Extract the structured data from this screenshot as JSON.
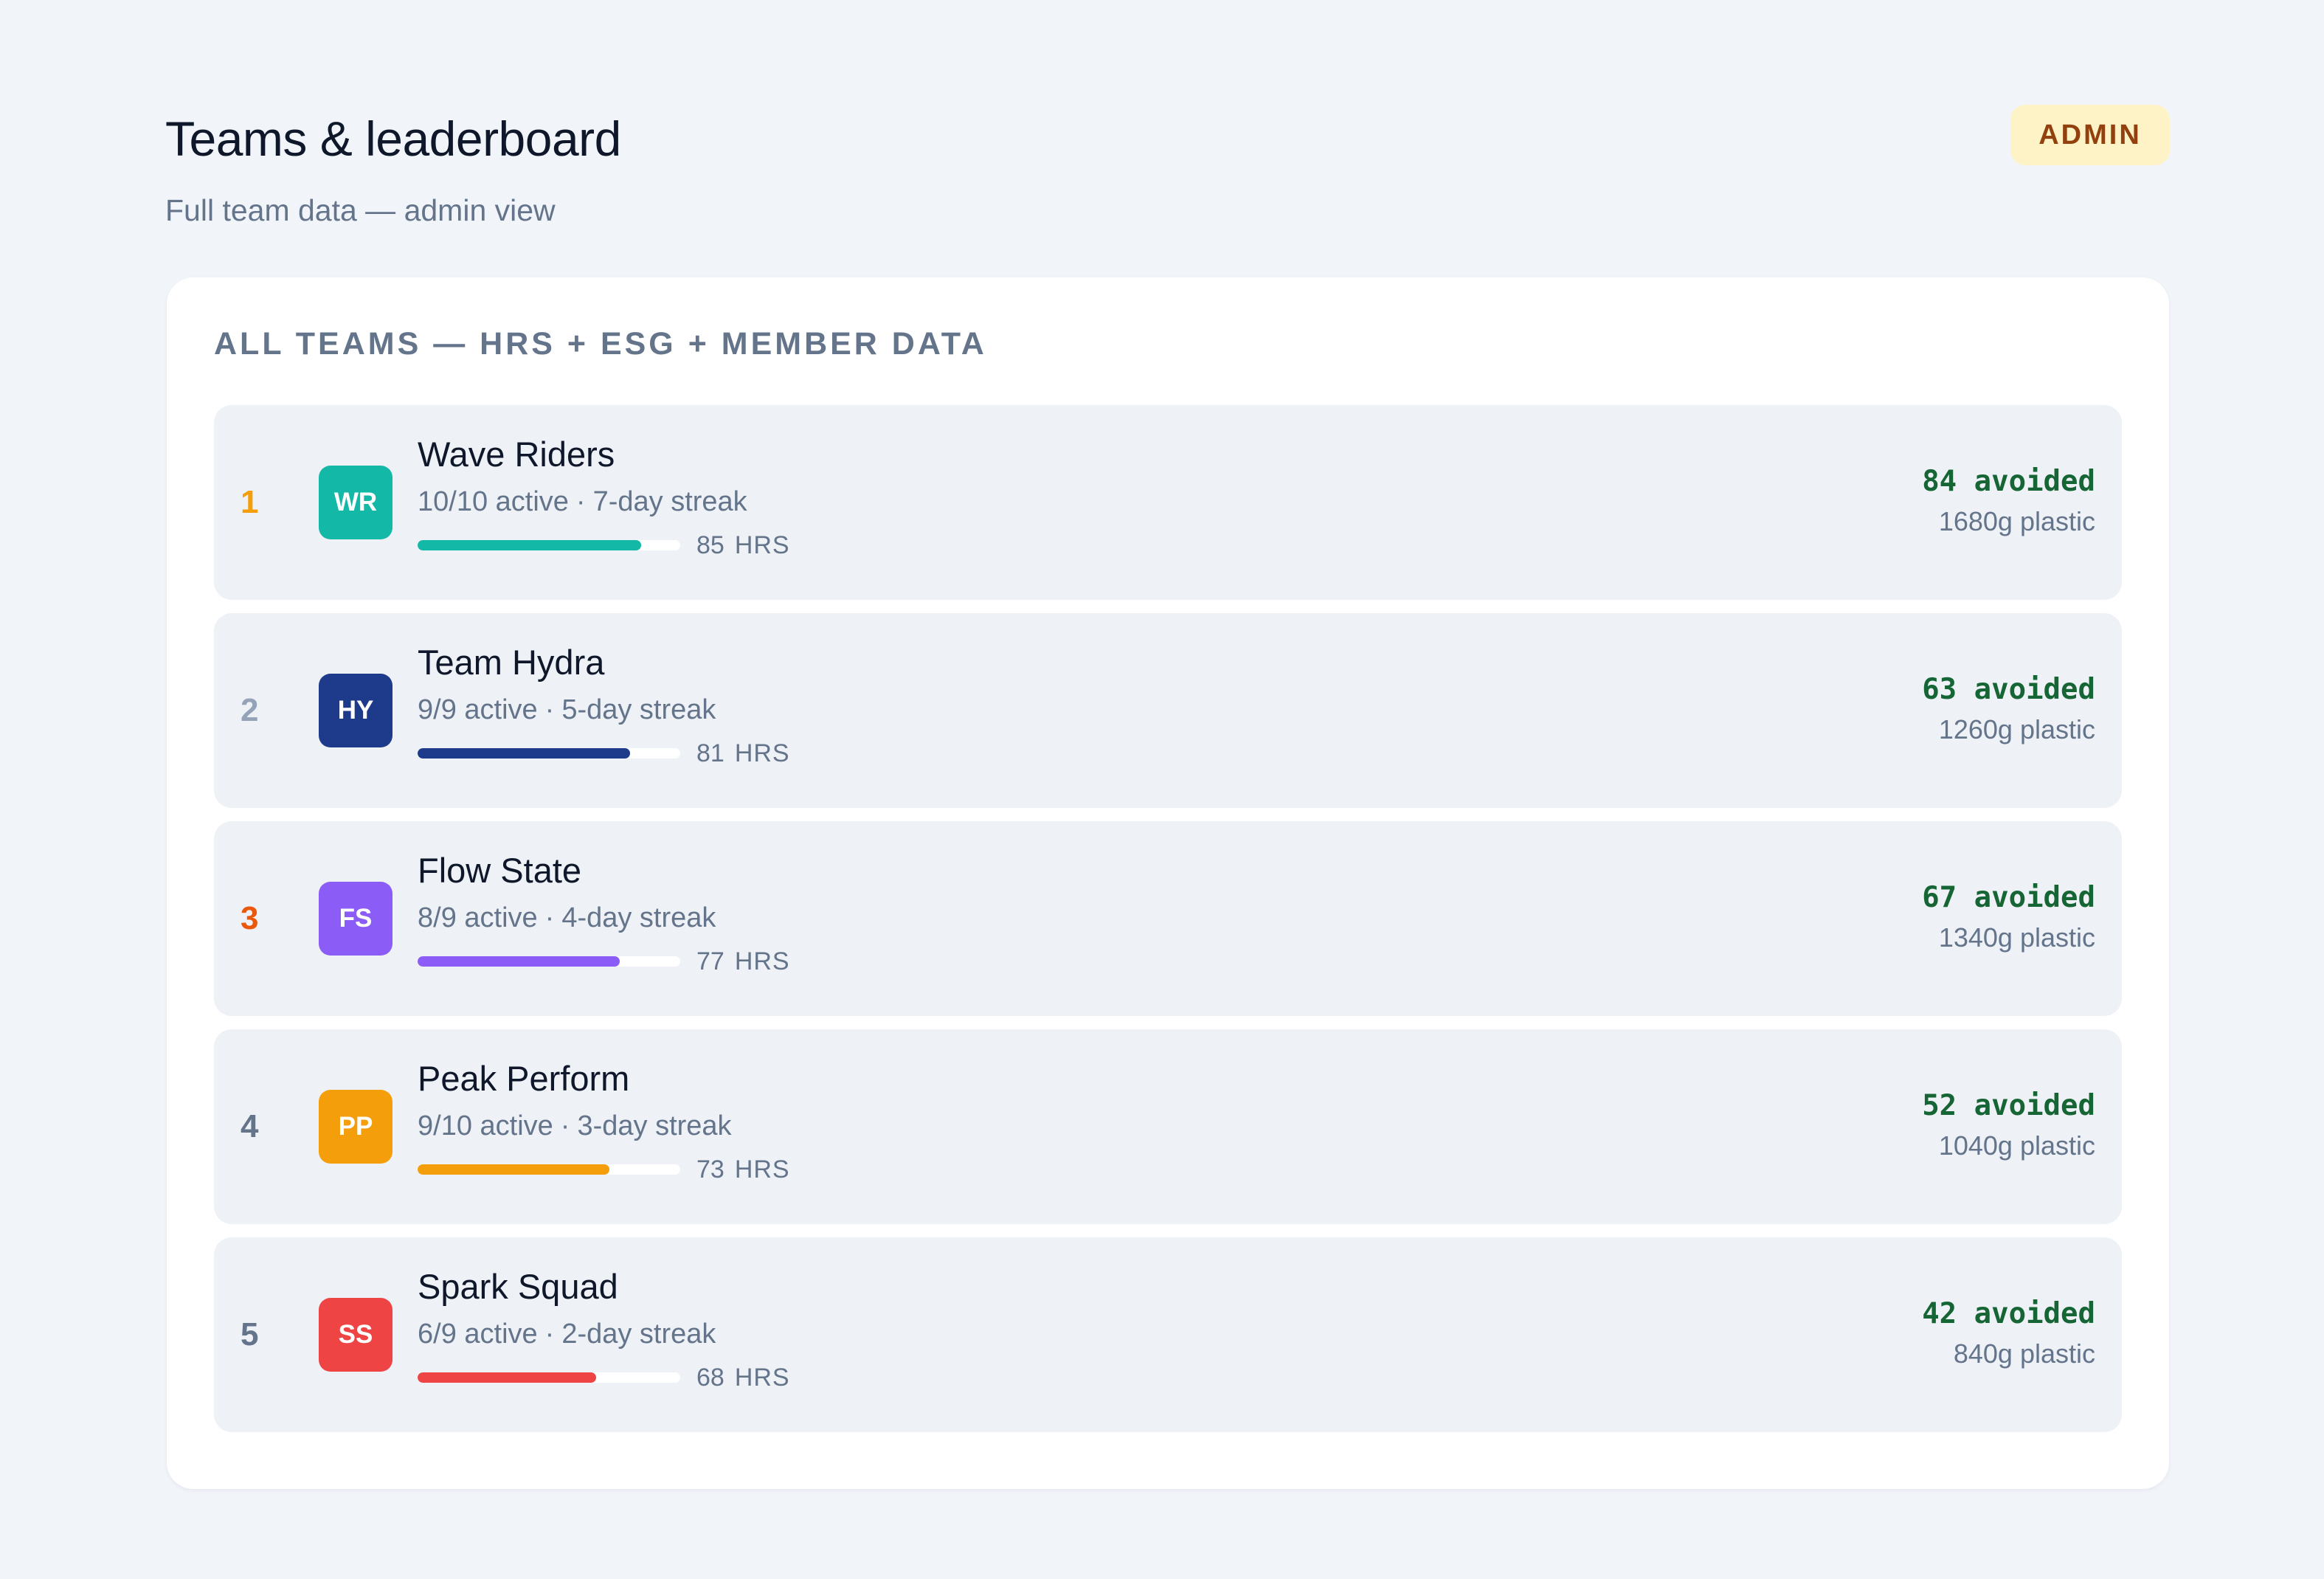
{
  "header": {
    "title": "Teams & leaderboard",
    "subtitle": "Full team data — admin view",
    "badge": "ADMIN"
  },
  "card": {
    "heading": "ALL TEAMS — HRS + ESG + MEMBER DATA"
  },
  "meta_separator": "·",
  "hrs_unit": "HRS",
  "teams": [
    {
      "rank": "1",
      "initials": "WR",
      "name": "Wave Riders",
      "active": "10/10 active",
      "streak": "7-day streak",
      "hrs": 85,
      "hrs_label": "85",
      "avoided": "84 avoided",
      "plastic": "1680g plastic",
      "color": "#14b8a6",
      "rank_color": "#f59e0b"
    },
    {
      "rank": "2",
      "initials": "HY",
      "name": "Team Hydra",
      "active": "9/9 active",
      "streak": "5-day streak",
      "hrs": 81,
      "hrs_label": "81",
      "avoided": "63 avoided",
      "plastic": "1260g plastic",
      "color": "#1e3a8a",
      "rank_color": "#94a3b8"
    },
    {
      "rank": "3",
      "initials": "FS",
      "name": "Flow State",
      "active": "8/9 active",
      "streak": "4-day streak",
      "hrs": 77,
      "hrs_label": "77",
      "avoided": "67 avoided",
      "plastic": "1340g plastic",
      "color": "#8b5cf6",
      "rank_color": "#ea580c"
    },
    {
      "rank": "4",
      "initials": "PP",
      "name": "Peak Perform",
      "active": "9/10 active",
      "streak": "3-day streak",
      "hrs": 73,
      "hrs_label": "73",
      "avoided": "52 avoided",
      "plastic": "1040g plastic",
      "color": "#f59e0b",
      "rank_color": "#64748b"
    },
    {
      "rank": "5",
      "initials": "SS",
      "name": "Spark Squad",
      "active": "6/9 active",
      "streak": "2-day streak",
      "hrs": 68,
      "hrs_label": "68",
      "avoided": "42 avoided",
      "plastic": "840g plastic",
      "color": "#ef4444",
      "rank_color": "#64748b"
    }
  ]
}
